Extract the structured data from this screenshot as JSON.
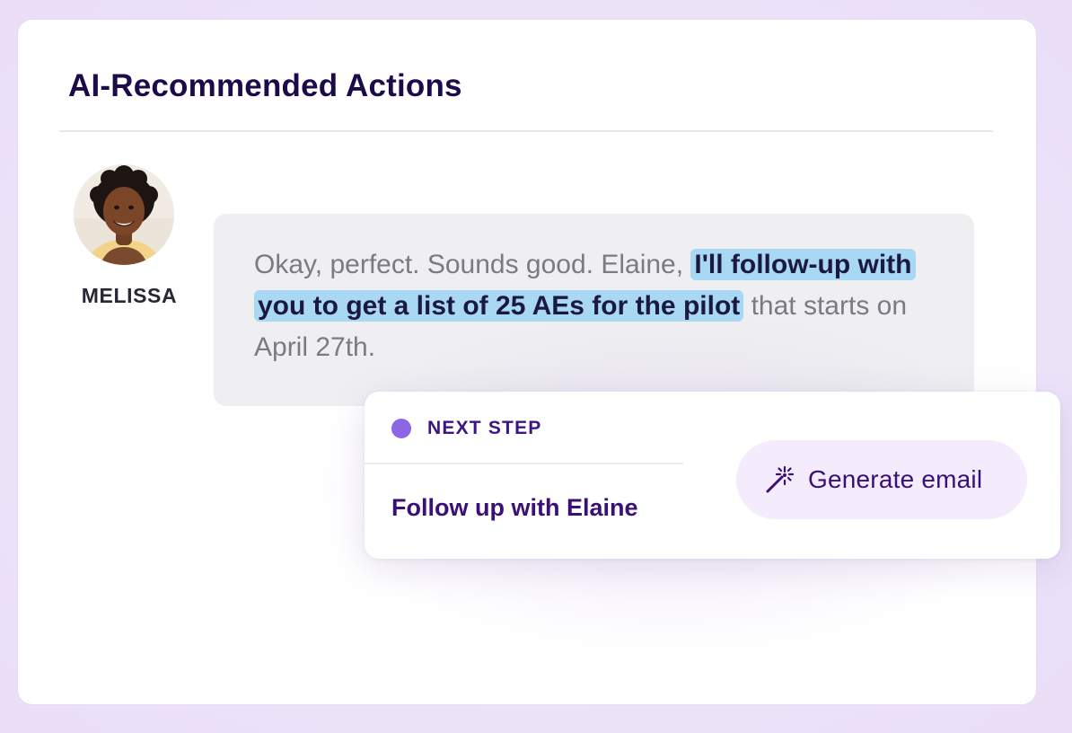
{
  "card": {
    "title": "AI-Recommended Actions"
  },
  "transcript": {
    "speaker": "MELISSA",
    "avatar_icon": "person-photo",
    "text_before": "Okay, perfect. Sounds good. Elaine, ",
    "text_highlight": "I'll follow-up with you to get a list of 25 AEs for the pilot",
    "text_after": " that starts on April 27th.",
    "highlight_color": "#a8d8f3"
  },
  "next_step": {
    "label": "NEXT STEP",
    "dot_color": "#8d66e3",
    "action": "Follow up with Elaine",
    "button_label": "Generate email",
    "button_icon": "magic-wand-icon"
  },
  "colors": {
    "background": "#efe6f9",
    "title": "#1c0b4a",
    "accent": "#3a0f78"
  }
}
